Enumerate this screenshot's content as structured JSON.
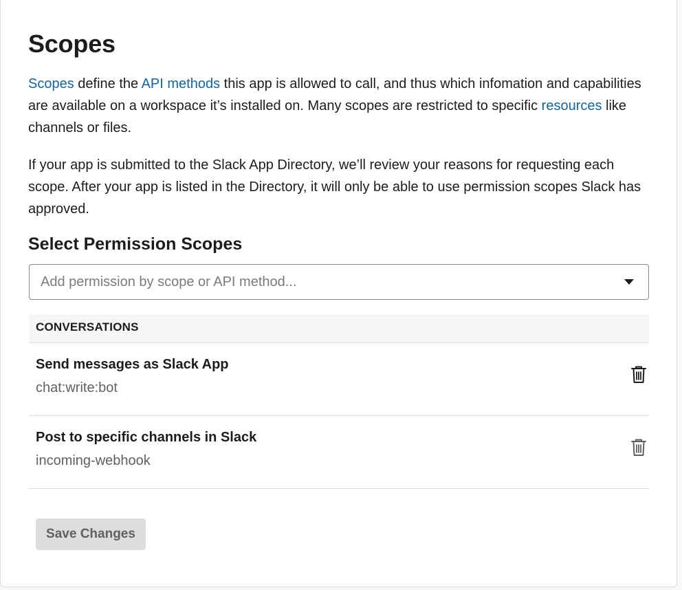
{
  "page": {
    "title": "Scopes"
  },
  "intro": {
    "link_scopes": "Scopes",
    "text_1": " define the ",
    "link_api_methods": "API methods",
    "text_2": " this app is allowed to call, and thus which infomation and capabilities are available on a workspace it’s installed on. Many scopes are restricted to specific ",
    "link_resources": "resources",
    "text_3": " like channels or files."
  },
  "review_note": "If your app is submitted to the Slack App Directory, we’ll review your reasons for requesting each scope. After your app is listed in the Directory, it will only be able to use permission scopes Slack has approved.",
  "select_scopes": {
    "heading": "Select Permission Scopes",
    "placeholder": "Add permission by scope or API method...",
    "value": "",
    "dropdown_icon": "caret-down-icon"
  },
  "groups": [
    {
      "label": "CONVERSATIONS",
      "items": [
        {
          "name": "Send messages as Slack App",
          "scope": "chat:write:bot",
          "icon": "trash-icon"
        },
        {
          "name": "Post to specific channels in Slack",
          "scope": "incoming-webhook",
          "icon": "trash-icon"
        }
      ]
    }
  ],
  "actions": {
    "save_label": "Save Changes"
  },
  "colors": {
    "link": "#1264a3",
    "text": "#1d1c1d",
    "muted": "#616061",
    "border": "#dddddd",
    "button_disabled_bg": "#dddddd"
  }
}
